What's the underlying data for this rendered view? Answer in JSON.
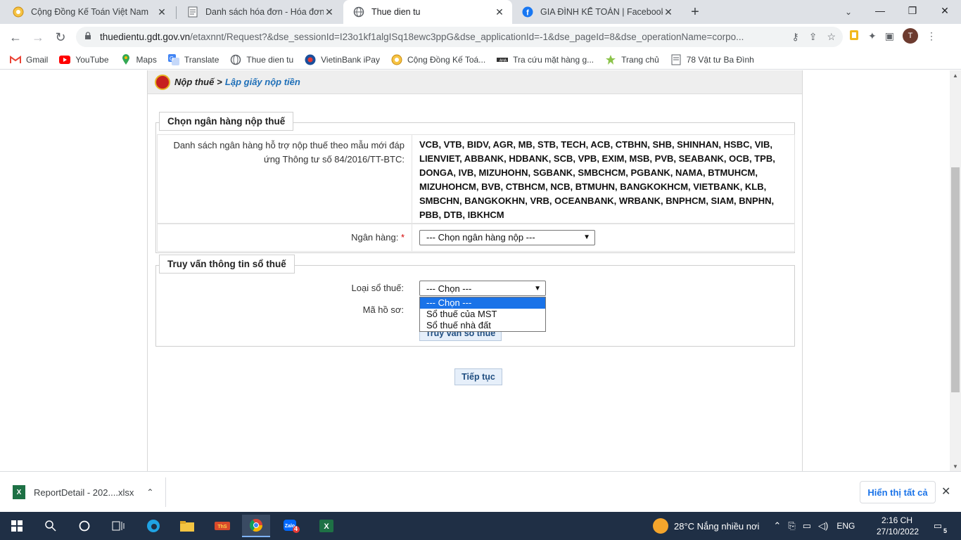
{
  "browser": {
    "tabs": [
      {
        "title": "Cộng Đồng Kế Toán Việt Nam",
        "favicon": "community-icon",
        "active": false
      },
      {
        "title": "Danh sách hóa đơn - Hóa đơn điện tử",
        "favicon": "document-icon",
        "active": false
      },
      {
        "title": "Thue dien tu",
        "favicon": "globe-icon",
        "active": true
      },
      {
        "title": "GIA ĐÌNH KẾ TOÁN | Facebook",
        "favicon": "facebook-icon",
        "active": false
      }
    ],
    "url_host": "thuedientu.gdt.gov.vn",
    "url_path": "/etaxnnt/Request?&dse_sessionId=I23o1kf1algISq18ewc3ppG&dse_applicationId=-1&dse_pageId=8&dse_operationName=corpo...",
    "avatar_letter": "T",
    "bookmarks": [
      {
        "label": "Gmail",
        "icon": "gmail-icon"
      },
      {
        "label": "YouTube",
        "icon": "youtube-icon"
      },
      {
        "label": "Maps",
        "icon": "maps-icon"
      },
      {
        "label": "Translate",
        "icon": "translate-icon"
      },
      {
        "label": "Thue dien tu",
        "icon": "globe-icon"
      },
      {
        "label": "VietinBank iPay",
        "icon": "bank-icon"
      },
      {
        "label": "Cộng Đồng Kế Toá...",
        "icon": "community-icon"
      },
      {
        "label": "Tra cứu mặt hàng g...",
        "icon": "search-icon"
      },
      {
        "label": "Trang chủ",
        "icon": "home-icon"
      },
      {
        "label": "78 Vật tư Ba Đình",
        "icon": "document-icon"
      }
    ]
  },
  "page": {
    "breadcrumb": {
      "parent": "Nộp thuế",
      "separator": ">",
      "current": "Lập giấy nộp tiền"
    },
    "bank_section": {
      "legend": "Chọn ngân hàng nộp thuế",
      "list_label": "Danh sách ngân hàng hỗ trợ nộp thuế theo mẫu mới đáp ứng Thông tư số 84/2016/TT-BTC:",
      "bank_list": "VCB, VTB, BIDV, AGR, MB, STB, TECH, ACB, CTBHN, SHB, SHINHAN, HSBC, VIB, LIENVIET, ABBANK, HDBANK, SCB, VPB, EXIM, MSB, PVB, SEABANK, OCB, TPB, DONGA, IVB, MIZUHOHN, SGBANK, SMBCHCM, PGBANK, NAMA, BTMUHCM, MIZUHOHCM, BVB, CTBHCM, NCB, BTMUHN, BANGKOKHCM, VIETBANK, KLB, SMBCHN, BANGKOKHN, VRB, OCEANBANK, WRBANK, BNPHCM, SIAM, BNPHN, PBB, DTB, IBKHCM",
      "bank_label": "Ngân hàng:",
      "required_mark": "*",
      "bank_select_value": "--- Chọn ngân hàng nộp ---"
    },
    "query_section": {
      "legend": "Truy vấn thông tin sổ thuế",
      "type_label": "Loại sổ thuế:",
      "type_select_value": "--- Chọn ---",
      "type_options": [
        "--- Chọn ---",
        "Sổ thuế của MST",
        "Sổ thuế nhà đất"
      ],
      "dossier_label": "Mã hồ sơ:",
      "query_button": "Truy vấn sổ thuế"
    },
    "continue_button": "Tiếp tục"
  },
  "downloads": {
    "file_name": "ReportDetail - 202....xlsx",
    "show_all": "Hiển thị tất cả"
  },
  "taskbar": {
    "weather": "28°C  Nắng nhiều nơi",
    "language": "ENG",
    "time": "2:16 CH",
    "date": "27/10/2022",
    "zalo_badge": "4",
    "notification_count": "5"
  }
}
